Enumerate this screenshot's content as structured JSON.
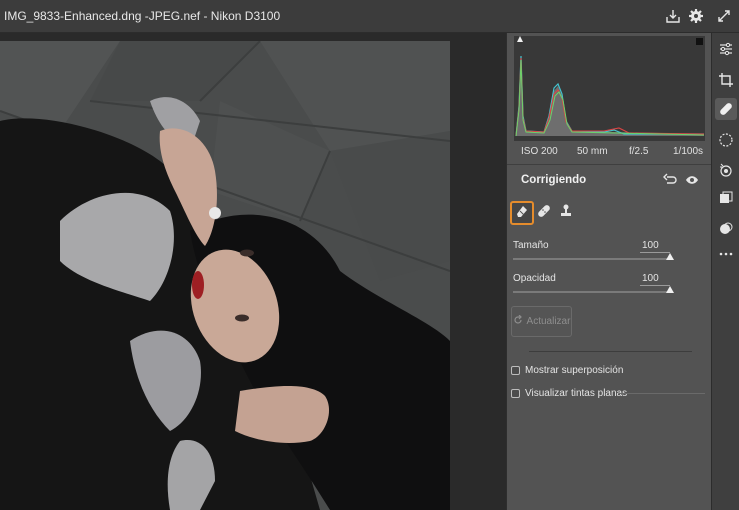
{
  "window": {
    "title": "IMG_9833-Enhanced.dng -JPEG.nef -  Nikon D3100"
  },
  "top_icons": [
    "download-icon",
    "gear-icon",
    "expand-icon"
  ],
  "histogram": {
    "exif": {
      "iso": "ISO 200",
      "focal": "50 mm",
      "aperture": "f/2.5",
      "shutter": "1/100s"
    }
  },
  "panel": {
    "section_title": "Corrigiendo",
    "tools": [
      "eraser-icon",
      "bandage-icon",
      "stamp-icon"
    ],
    "size": {
      "label": "Tamaño",
      "value": "100",
      "fraction": 1.0
    },
    "opacity": {
      "label": "Opacidad",
      "value": "100",
      "fraction": 1.0
    },
    "refresh_label": "Actualizar",
    "show_overlay": {
      "label": "Mostrar superposición",
      "checked": false
    },
    "flat_tints": {
      "label": "Visualizar tintas planas",
      "checked": false
    }
  },
  "toolbar": [
    "sliders-icon",
    "crop-icon",
    "healing-icon",
    "mask-icon",
    "redeye-icon",
    "presets-icon",
    "snapshots-icon",
    "more-icon"
  ],
  "colors": {
    "accent": "#e58c2c",
    "panel_bg": "#535353",
    "canvas_bg": "#2a2a2a"
  }
}
